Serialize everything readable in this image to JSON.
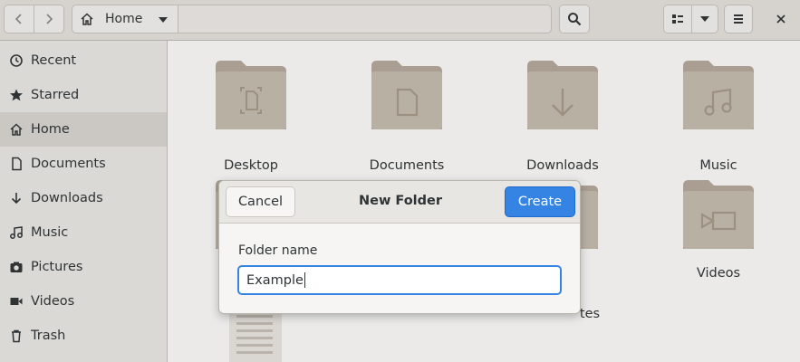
{
  "header": {
    "path_label": "Home"
  },
  "sidebar": {
    "items": [
      {
        "label": "Recent",
        "icon": "clock-icon"
      },
      {
        "label": "Starred",
        "icon": "star-icon"
      },
      {
        "label": "Home",
        "icon": "home-icon",
        "active": true
      },
      {
        "label": "Documents",
        "icon": "document-icon"
      },
      {
        "label": "Downloads",
        "icon": "download-icon"
      },
      {
        "label": "Music",
        "icon": "music-icon"
      },
      {
        "label": "Pictures",
        "icon": "camera-icon"
      },
      {
        "label": "Videos",
        "icon": "video-icon"
      },
      {
        "label": "Trash",
        "icon": "trash-icon"
      }
    ]
  },
  "files": [
    {
      "name": "Desktop",
      "icon": "desktop-folder-icon"
    },
    {
      "name": "Documents",
      "icon": "documents-folder-icon"
    },
    {
      "name": "Downloads",
      "icon": "downloads-folder-icon"
    },
    {
      "name": "Music",
      "icon": "music-folder-icon"
    },
    {
      "name": "tes",
      "icon": "folder-icon"
    },
    {
      "name": "Videos",
      "icon": "videos-folder-icon"
    }
  ],
  "dialog": {
    "title": "New Folder",
    "cancel_label": "Cancel",
    "create_label": "Create",
    "field_label": "Folder name",
    "field_value": "Example"
  },
  "colors": {
    "accent": "#3584e4",
    "folder": "#c8bfb3",
    "folder_dark": "#b6ab9e"
  }
}
